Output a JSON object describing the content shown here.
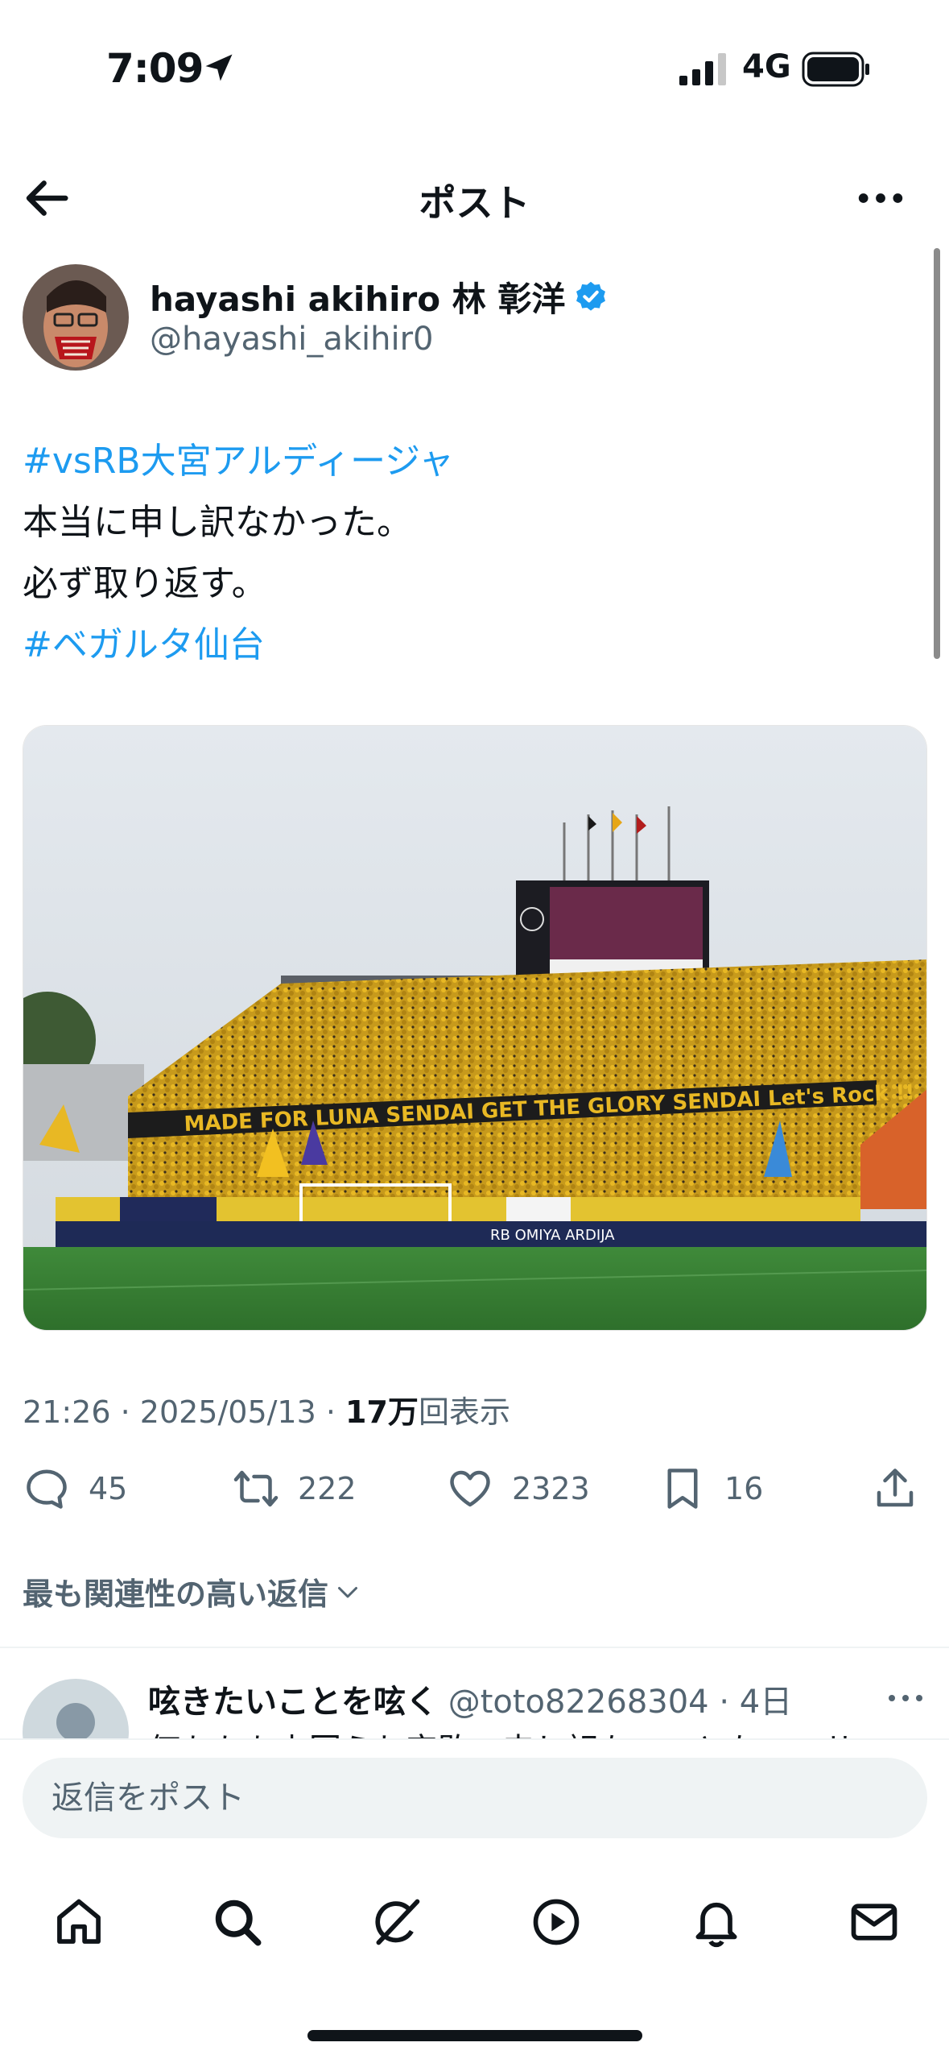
{
  "status_bar": {
    "time": "7:09",
    "network": "4G"
  },
  "header": {
    "title": "ポスト"
  },
  "author": {
    "name": "hayashi akihiro 林 彰洋",
    "handle": "@hayashi_akihir0",
    "verified": true
  },
  "tweet": {
    "lines": [
      {
        "text": "#vsRB大宮アルディージャ",
        "type": "hashtag"
      },
      {
        "text": "本当に申し訳なかった。",
        "type": "text"
      },
      {
        "text": "必ず取り返す。",
        "type": "text"
      },
      {
        "text": "#ベガルタ仙台",
        "type": "hashtag"
      }
    ]
  },
  "media": {
    "banner_text": "MADE FOR LUNA SENDAI GET THE GLORY SENDAI Let's Rock !!",
    "ad_text": "RB OMIYA ARDIJA"
  },
  "meta": {
    "time": "21:26",
    "date": "2025/05/13",
    "separator": " · ",
    "views_count": "17万",
    "views_label": "回表示"
  },
  "actions": {
    "replies": "45",
    "retweets": "222",
    "likes": "2323",
    "bookmarks": "16"
  },
  "sort": {
    "label": "最も関連性の高い返信"
  },
  "reply_preview": {
    "name": "呟きたいことを呟く",
    "handle": "@toto82268304",
    "time": "· 4日",
    "text": "何もかも上回られ完敗。申し訳ないことない。サ"
  },
  "composer": {
    "placeholder": "返信をポスト"
  },
  "tabs": [
    "home-icon",
    "search-icon",
    "grok-icon",
    "video-icon",
    "bell-icon",
    "mail-icon"
  ],
  "colors": {
    "accent": "#1d9bf0",
    "text": "#0f1419",
    "secondary": "#536471"
  }
}
